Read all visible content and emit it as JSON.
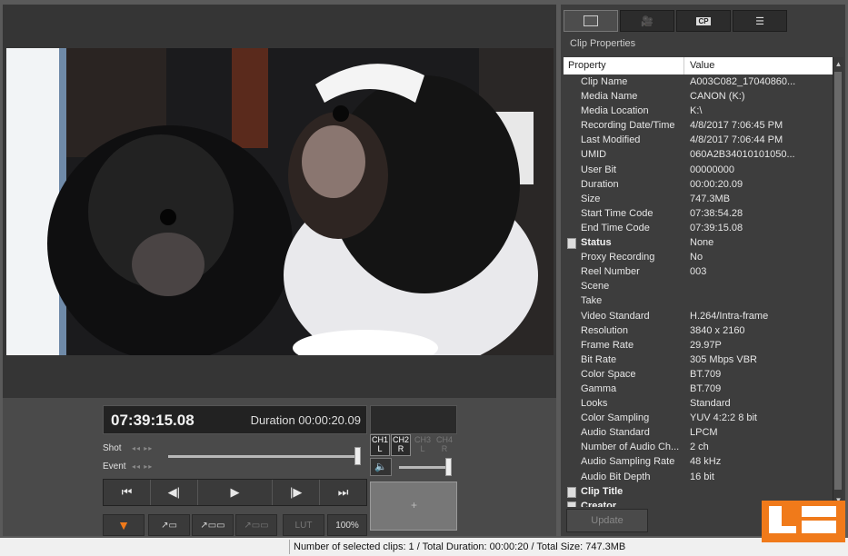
{
  "player": {
    "timecode": "07:39:15.08",
    "duration_text": "Duration 00:00:20.09",
    "shot_label": "Shot",
    "event_label": "Event",
    "channels": [
      {
        "top": "CH1",
        "bottom": "L",
        "active": true
      },
      {
        "top": "CH2",
        "bottom": "R",
        "active": true
      },
      {
        "top": "CH3",
        "bottom": "L",
        "active": false
      },
      {
        "top": "CH4",
        "bottom": "R",
        "active": false
      }
    ],
    "transport": [
      "⏮",
      "◀|",
      "▶",
      "|▶",
      "⏭"
    ],
    "lut_label": "LUT",
    "zoom_label": "100%",
    "colors": {
      "accent": "#f07a1a"
    }
  },
  "panel": {
    "tabs": [
      "clip-icon",
      "camera-icon",
      "cp-icon",
      "list-icon"
    ],
    "tab_cp_label": "CP",
    "title": "Clip Properties",
    "col_property": "Property",
    "col_value": "Value",
    "rows": [
      {
        "k": "Clip Name",
        "v": "A003C082_17040860..."
      },
      {
        "k": "Media Name",
        "v": "CANON (K:)"
      },
      {
        "k": "Media Location",
        "v": "K:\\"
      },
      {
        "k": "Recording Date/Time",
        "v": "4/8/2017 7:06:45 PM"
      },
      {
        "k": "Last Modified",
        "v": "4/8/2017 7:06:44 PM"
      },
      {
        "k": "UMID",
        "v": "060A2B34010101050..."
      },
      {
        "k": "User Bit",
        "v": "00000000"
      },
      {
        "k": "Duration",
        "v": "00:00:20.09"
      },
      {
        "k": "Size",
        "v": "747.3MB"
      },
      {
        "k": "Start Time Code",
        "v": "07:38:54.28"
      },
      {
        "k": "End Time Code",
        "v": "07:39:15.08"
      },
      {
        "k": "Status",
        "v": "None",
        "group": true
      },
      {
        "k": "Proxy Recording",
        "v": "No"
      },
      {
        "k": "Reel Number",
        "v": "003"
      },
      {
        "k": "Scene",
        "v": ""
      },
      {
        "k": "Take",
        "v": ""
      },
      {
        "k": "Video Standard",
        "v": "H.264/Intra-frame"
      },
      {
        "k": "Resolution",
        "v": "3840 x 2160"
      },
      {
        "k": "Frame Rate",
        "v": "29.97P"
      },
      {
        "k": "Bit Rate",
        "v": "305 Mbps VBR"
      },
      {
        "k": "Color Space",
        "v": "BT.709"
      },
      {
        "k": "Gamma",
        "v": "BT.709"
      },
      {
        "k": "Looks",
        "v": "Standard"
      },
      {
        "k": "Color Sampling",
        "v": "YUV 4:2:2 8 bit"
      },
      {
        "k": "Audio Standard",
        "v": "LPCM"
      },
      {
        "k": "Number of Audio Ch...",
        "v": "2 ch"
      },
      {
        "k": "Audio Sampling Rate",
        "v": "48 kHz"
      },
      {
        "k": "Audio Bit Depth",
        "v": "16 bit"
      },
      {
        "k": "Clip Title",
        "v": "",
        "group": true
      },
      {
        "k": "Creator",
        "v": "",
        "group": true
      }
    ],
    "update_label": "Update"
  },
  "statusbar": {
    "text": "Number of selected clips: 1 / Total Duration: 00:00:20 / Total Size: 747.3MB"
  }
}
